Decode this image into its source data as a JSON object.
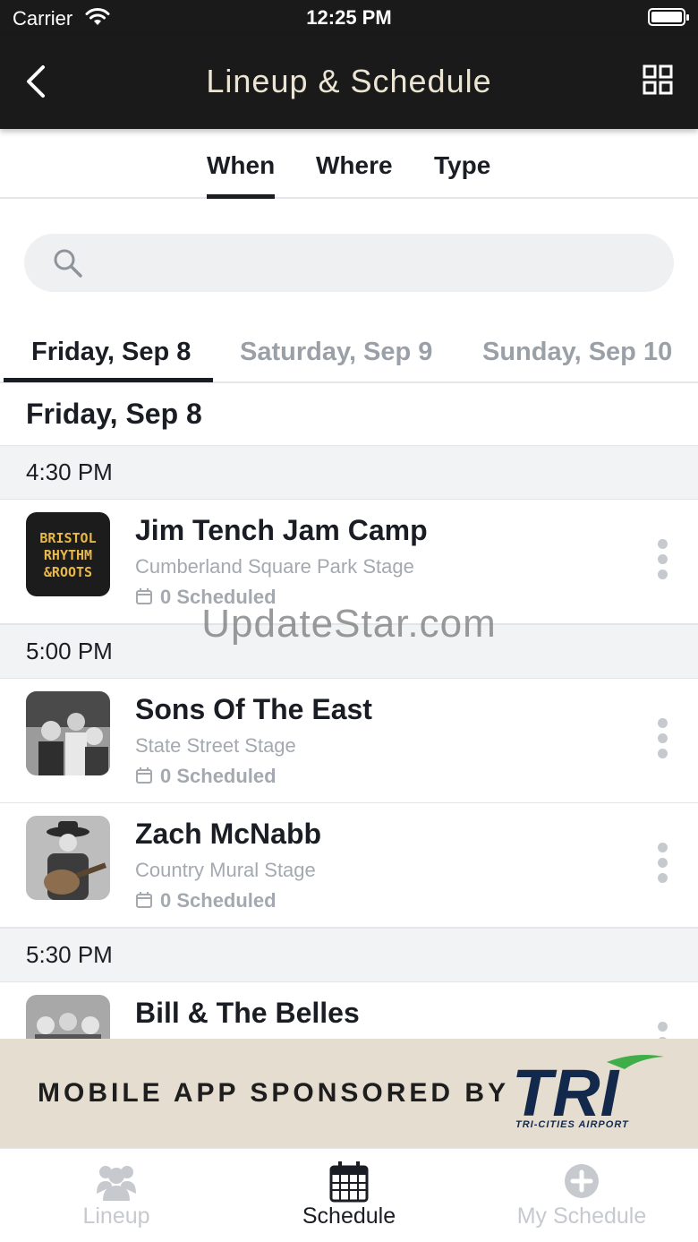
{
  "status_bar": {
    "carrier": "Carrier",
    "time": "12:25 PM"
  },
  "header": {
    "title": "Lineup & Schedule",
    "back_icon": "chevron-left-icon",
    "view_icon": "grid-icon"
  },
  "filter_tabs": [
    {
      "label": "When",
      "active": true
    },
    {
      "label": "Where",
      "active": false
    },
    {
      "label": "Type",
      "active": false
    }
  ],
  "search": {
    "placeholder": "",
    "value": ""
  },
  "day_tabs": [
    {
      "label": "Friday, Sep 8",
      "active": true
    },
    {
      "label": "Saturday, Sep 9",
      "active": false
    },
    {
      "label": "Sunday, Sep 10",
      "active": false
    }
  ],
  "day_heading": "Friday, Sep 8",
  "time_groups": [
    {
      "time": "4:30 PM",
      "events": [
        {
          "title": "Jim Tench Jam Camp",
          "stage": "Cumberland Square Park Stage",
          "scheduled": "0 Scheduled",
          "thumb_text": "BRISTOL RHYTHM & ROOTS"
        }
      ]
    },
    {
      "time": "5:00 PM",
      "events": [
        {
          "title": "Sons Of The East",
          "stage": "State Street Stage",
          "scheduled": "0 Scheduled"
        },
        {
          "title": "Zach McNabb",
          "stage": "Country Mural Stage",
          "scheduled": "0 Scheduled"
        }
      ]
    },
    {
      "time": "5:30 PM",
      "events": [
        {
          "title": "Bill & The Belles",
          "stage": "",
          "scheduled": ""
        }
      ]
    }
  ],
  "watermark": "UpdateStar.com",
  "sponsor": {
    "text": "MOBILE APP SPONSORED BY",
    "logo_text": "TRI",
    "logo_subtext": "TRI-CITIES AIRPORT"
  },
  "bottom_nav": [
    {
      "label": "Lineup",
      "icon": "people-icon",
      "active": false
    },
    {
      "label": "Schedule",
      "icon": "calendar-icon",
      "active": true
    },
    {
      "label": "My Schedule",
      "icon": "plus-circle-icon",
      "active": false
    }
  ],
  "colors": {
    "header_bg": "#1a1a1a",
    "header_title": "#ece5d3",
    "sponsor_bg": "#e5ddd0",
    "airport_blue": "#13294b",
    "airport_green": "#3fae49"
  }
}
